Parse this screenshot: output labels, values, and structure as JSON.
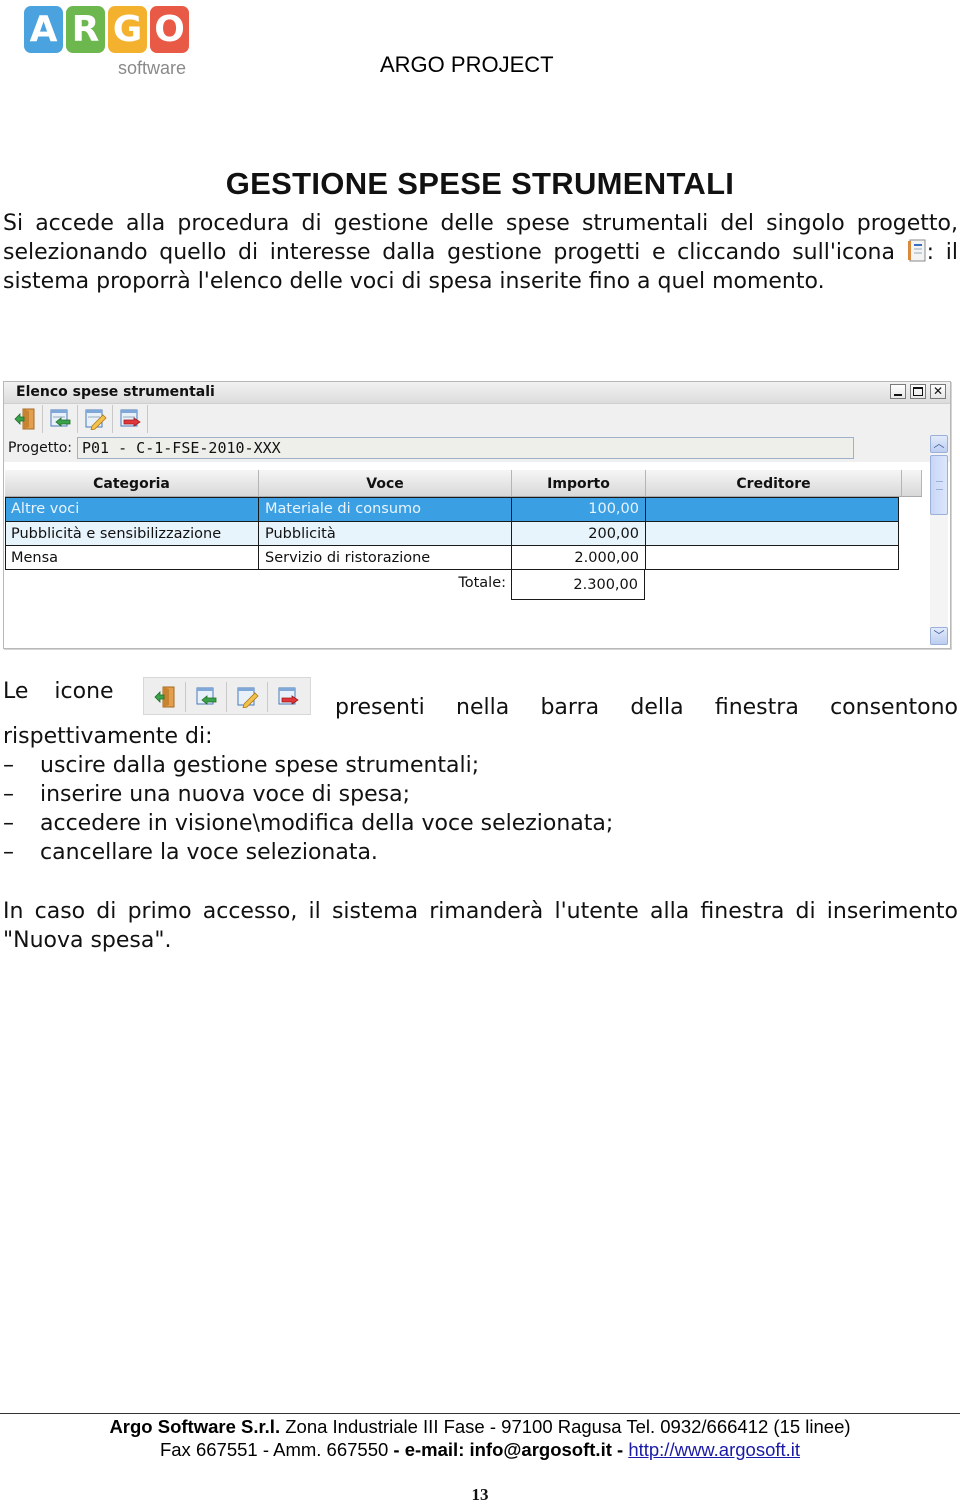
{
  "header": {
    "logo_letters": [
      "A",
      "R",
      "G",
      "O"
    ],
    "logo_colors": [
      "#4aa3df",
      "#6cb84e",
      "#f4b12e",
      "#e85a45"
    ],
    "logo_subtitle": "software",
    "project_title": "ARGO PROJECT"
  },
  "title": "GESTIONE SPESE STRUMENTALI",
  "intro": {
    "before_icon": "Si accede alla procedura di gestione delle spese strumentali del singolo progetto, selezionando quello di interesse dalla gestione progetti e cliccando sull'icona ",
    "icon": "expense-list-icon",
    "after_icon": ": il sistema proporrà l'elenco delle  voci di spesa inserite fino a quel momento."
  },
  "window": {
    "title": "Elenco spese strumentali",
    "controls": [
      "minimize-icon",
      "maximize-icon",
      "close-icon"
    ],
    "toolbar_icons": [
      "exit-door-icon",
      "insert-row-icon",
      "edit-pencil-icon",
      "delete-row-icon"
    ],
    "project_label": "Progetto:",
    "project_value": "P01 - C-1-FSE-2010-XXX",
    "columns": [
      "Categoria",
      "Voce",
      "Importo",
      "Creditore"
    ],
    "rows": [
      {
        "categoria": "Altre voci",
        "voce": "Materiale di consumo",
        "importo": "100,00",
        "creditore": "",
        "selected": true
      },
      {
        "categoria": "Pubblicità e sensibilizzazione",
        "voce": "Pubblicità",
        "importo": "200,00",
        "creditore": ""
      },
      {
        "categoria": "Mensa",
        "voce": "Servizio di ristorazione",
        "importo": "2.000,00",
        "creditore": ""
      }
    ],
    "total_label": "Totale:",
    "total_value": "2.300,00",
    "selection_color": "#3a9fe3"
  },
  "icons_paragraph": {
    "before": "Le icone",
    "after": "presenti nella barra della finestra consentono rispettivamente di:",
    "items": [
      "uscire dalla gestione spese strumentali;",
      "inserire una nuova voce di spesa;",
      "accedere in visione\\modifica della voce selezionata;",
      "cancellare la voce selezionata."
    ],
    "bullet": "–"
  },
  "closing": "In caso di primo accesso, il sistema rimanderà l'utente alla finestra di inserimento \"Nuova spesa\".",
  "footer": {
    "company": "Argo Software S.r.l.",
    "address": " Zona Industriale III Fase - 97100 Ragusa Tel. 0932/666412 (15 linee)",
    "fax": "Fax 667551 - Amm. 667550",
    "email_label": " - e-mail: info@argosoft.it - ",
    "website": "http://www.argosoft.it",
    "page_number": "13"
  }
}
